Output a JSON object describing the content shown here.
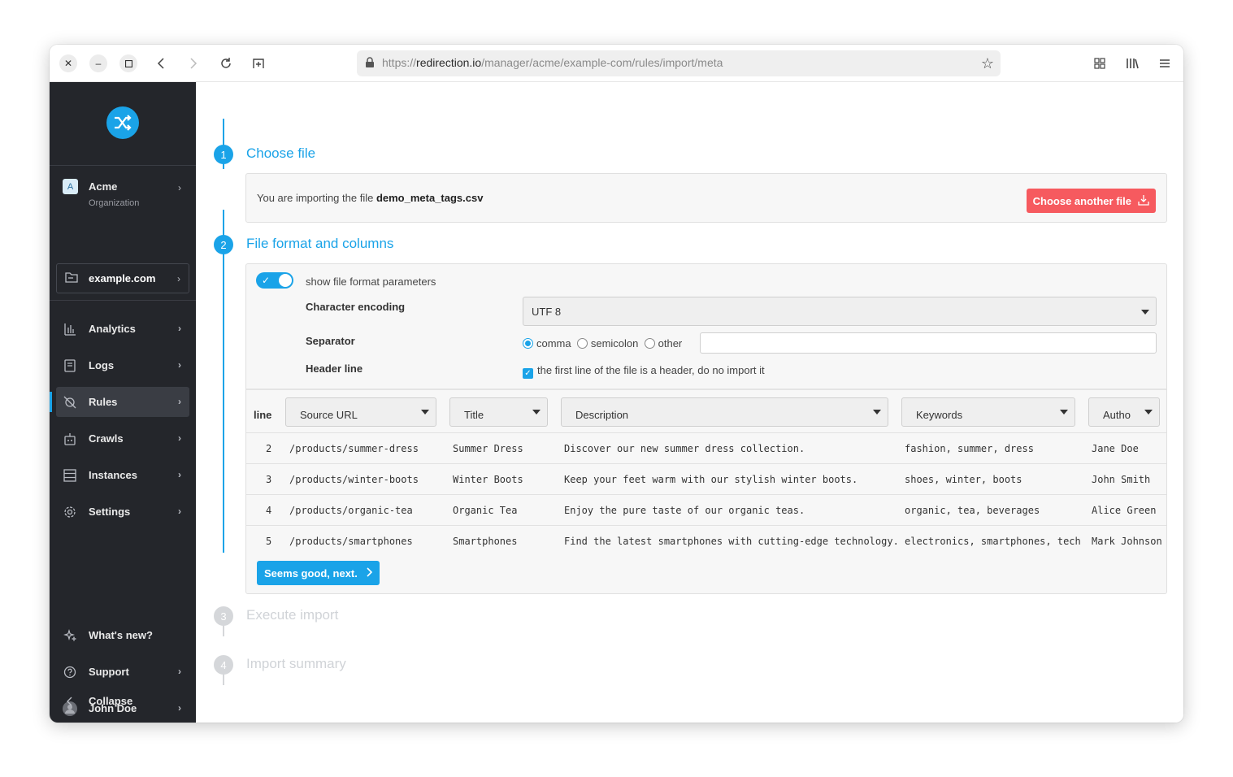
{
  "browser": {
    "url_prefix": "https://",
    "url_domain": "redirection.io",
    "url_path": "/manager/acme/example-com/rules/import/meta"
  },
  "sidebar": {
    "org": {
      "badge": "A",
      "name": "Acme",
      "sub": "Organization"
    },
    "site": "example.com",
    "items": [
      {
        "label": "Analytics",
        "icon": "analytics-icon"
      },
      {
        "label": "Logs",
        "icon": "logs-icon"
      },
      {
        "label": "Rules",
        "icon": "rules-icon",
        "active": true
      },
      {
        "label": "Crawls",
        "icon": "crawls-icon"
      },
      {
        "label": "Instances",
        "icon": "instances-icon"
      },
      {
        "label": "Settings",
        "icon": "gear-icon"
      }
    ],
    "bottom": [
      {
        "label": "What's new?",
        "icon": "sparkles-icon"
      },
      {
        "label": "Support",
        "icon": "help-icon"
      },
      {
        "label": "John Doe",
        "icon": "avatar"
      },
      {
        "label": "Collapse",
        "icon": "chevron-left-icon"
      }
    ]
  },
  "steps": [
    {
      "num": "1",
      "title": "Choose file"
    },
    {
      "num": "2",
      "title": "File format and columns"
    },
    {
      "num": "3",
      "title": "Execute import"
    },
    {
      "num": "4",
      "title": "Import summary"
    }
  ],
  "choose_file": {
    "text": "You are importing the file ",
    "filename": "demo_meta_tags.csv",
    "button": "Choose another file"
  },
  "format": {
    "toggle_label": "show file format parameters",
    "encoding_label": "Character encoding",
    "encoding_value": "UTF 8",
    "separator_label": "Separator",
    "separator_options": [
      "comma",
      "semicolon",
      "other"
    ],
    "separator_selected": "comma",
    "header_label": "Header line",
    "header_checkbox": "the first line of the file is a header, do no import it"
  },
  "table": {
    "line_header": "line",
    "columns": [
      "Source URL",
      "Title",
      "Description",
      "Keywords",
      "Autho"
    ],
    "rows": [
      {
        "line": "2",
        "url": "/products/summer-dress",
        "title": "Summer Dress",
        "desc": "Discover our new summer dress collection.",
        "kw": "fashion, summer, dress",
        "author": "Jane Doe"
      },
      {
        "line": "3",
        "url": "/products/winter-boots",
        "title": "Winter Boots",
        "desc": "Keep your feet warm with our stylish winter boots.",
        "kw": "shoes, winter, boots",
        "author": "John Smith"
      },
      {
        "line": "4",
        "url": "/products/organic-tea",
        "title": "Organic Tea",
        "desc": "Enjoy the pure taste of our organic teas.",
        "kw": "organic, tea, beverages",
        "author": "Alice Green"
      },
      {
        "line": "5",
        "url": "/products/smartphones",
        "title": "Smartphones",
        "desc": "Find the latest smartphones with cutting-edge technology.",
        "kw": "electronics, smartphones, tech",
        "author": "Mark Johnson"
      }
    ]
  },
  "next_button": "Seems good, next.",
  "colors": {
    "accent": "#1aa3e8",
    "danger": "#f65a5f",
    "sidebar": "#24262b"
  }
}
